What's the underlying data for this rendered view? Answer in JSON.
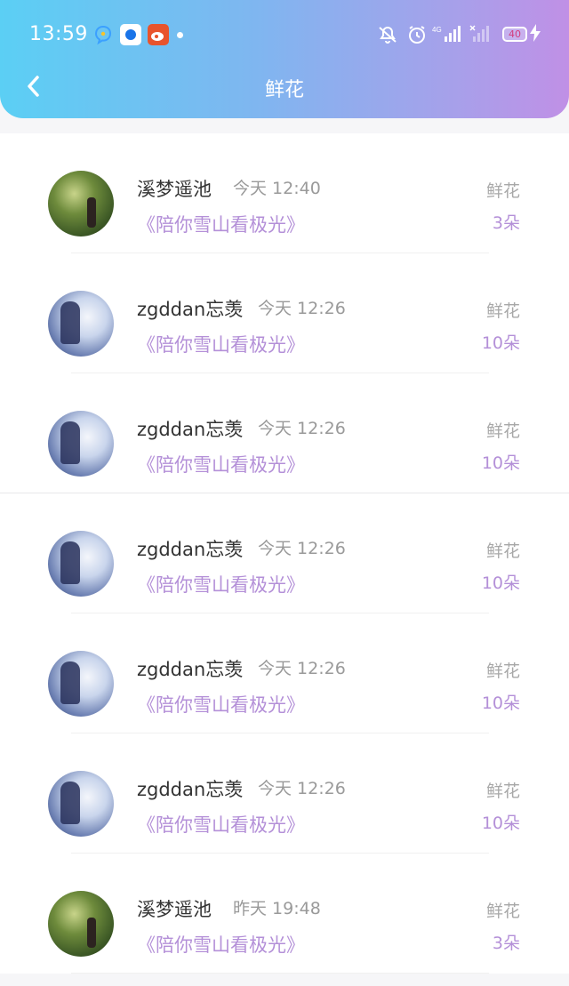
{
  "status_bar": {
    "time": "13:59",
    "battery": "40"
  },
  "header": {
    "title": "鲜花"
  },
  "rows": [
    {
      "name": "溪梦遥池",
      "date": "今天 12:40",
      "book": "《陪你雪山看极光》",
      "type": "鲜花",
      "count": "3朵",
      "avatar": "forest"
    },
    {
      "name": "zgddan忘羡",
      "date": "今天 12:26",
      "book": "《陪你雪山看极光》",
      "type": "鲜花",
      "count": "10朵",
      "avatar": "snow"
    },
    {
      "name": "zgddan忘羡",
      "date": "今天 12:26",
      "book": "《陪你雪山看极光》",
      "type": "鲜花",
      "count": "10朵",
      "avatar": "snow"
    },
    {
      "name": "zgddan忘羡",
      "date": "今天 12:26",
      "book": "《陪你雪山看极光》",
      "type": "鲜花",
      "count": "10朵",
      "avatar": "snow"
    },
    {
      "name": "zgddan忘羡",
      "date": "今天 12:26",
      "book": "《陪你雪山看极光》",
      "type": "鲜花",
      "count": "10朵",
      "avatar": "snow"
    },
    {
      "name": "zgddan忘羡",
      "date": "今天 12:26",
      "book": "《陪你雪山看极光》",
      "type": "鲜花",
      "count": "10朵",
      "avatar": "snow"
    },
    {
      "name": "溪梦遥池",
      "date": "昨天 19:48",
      "book": "《陪你雪山看极光》",
      "type": "鲜花",
      "count": "3朵",
      "avatar": "forest"
    }
  ]
}
